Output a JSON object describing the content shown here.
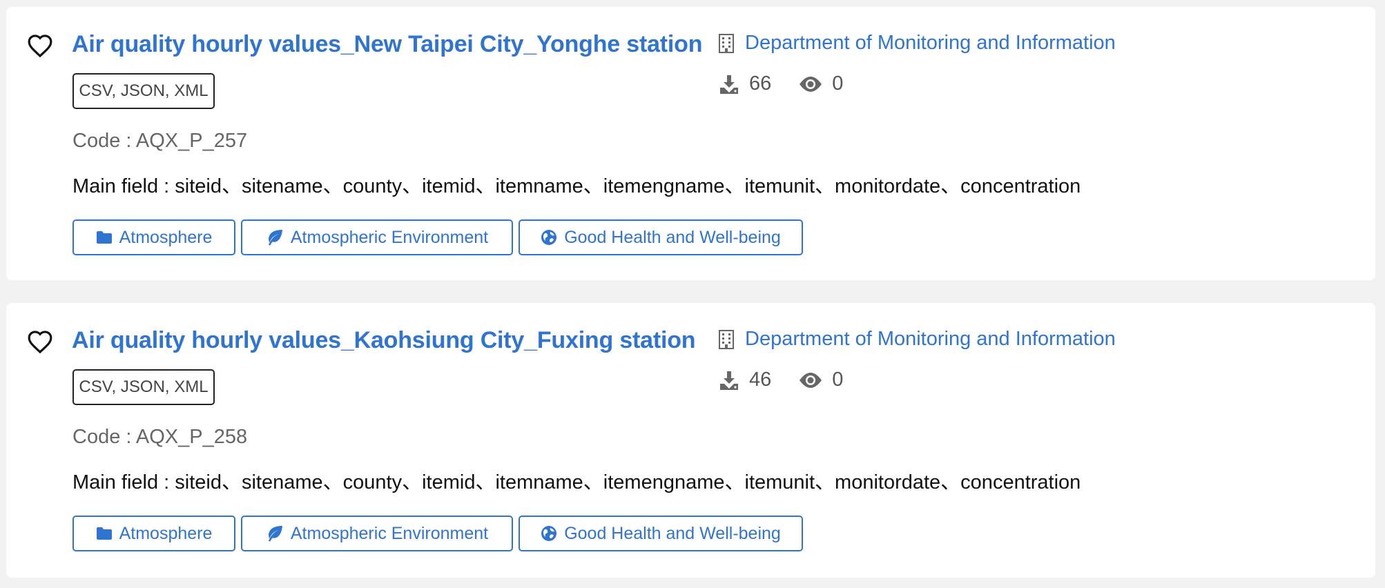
{
  "datasets": [
    {
      "title": "Air quality hourly values_New Taipei City_Yonghe station",
      "formats": "CSV, JSON, XML",
      "code": "Code : AQX_P_257",
      "main_field": "Main field : siteid、sitename、county、itemid、itemname、itemengname、itemunit、monitordate、concentration",
      "tags": [
        {
          "label": "Atmosphere",
          "icon": "folder-icon"
        },
        {
          "label": "Atmospheric Environment",
          "icon": "leaf-icon"
        },
        {
          "label": "Good Health and Well-being",
          "icon": "globe-icon"
        }
      ],
      "department": "Department of Monitoring and Information",
      "downloads": "66",
      "views": "0"
    },
    {
      "title": "Air quality hourly values_Kaohsiung City_Fuxing station",
      "formats": "CSV, JSON, XML",
      "code": "Code : AQX_P_258",
      "main_field": "Main field : siteid、sitename、county、itemid、itemname、itemengname、itemunit、monitordate、concentration",
      "tags": [
        {
          "label": "Atmosphere",
          "icon": "folder-icon"
        },
        {
          "label": "Atmospheric Environment",
          "icon": "leaf-icon"
        },
        {
          "label": "Good Health and Well-being",
          "icon": "globe-icon"
        }
      ],
      "department": "Department of Monitoring and Information",
      "downloads": "46",
      "views": "0"
    }
  ],
  "colors": {
    "accent": "#2f74d0",
    "background": "#f2f2f2",
    "card": "#ffffff",
    "muted_text": "#666666"
  }
}
